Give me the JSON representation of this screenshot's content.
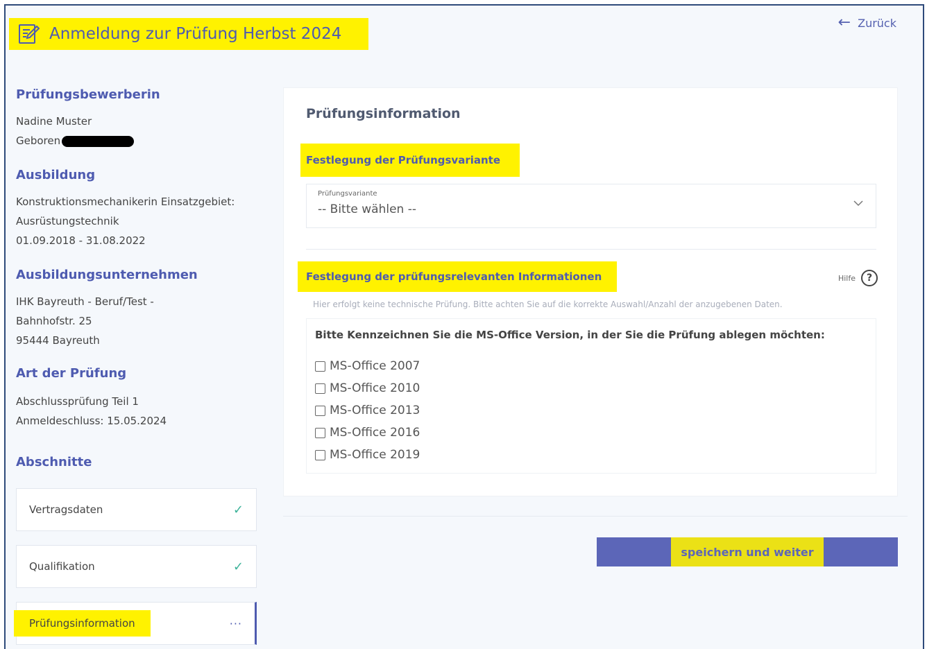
{
  "header": {
    "title": "Anmeldung zur Prüfung Herbst 2024",
    "back_label": "Zurück"
  },
  "sidebar": {
    "candidate_heading": "Prüfungsbewerberin",
    "candidate_name": "Nadine Muster",
    "born_label": "Geboren",
    "training_heading": "Ausbildung",
    "training_line1": "Konstruktionsmechanikerin Einsatzgebiet:",
    "training_line2": "Ausrüstungstechnik",
    "training_period": "01.09.2018 - 31.08.2022",
    "company_heading": "Ausbildungsunternehmen",
    "company_line1": "IHK Bayreuth - Beruf/Test -",
    "company_line2": "Bahnhofstr. 25",
    "company_line3": "95444 Bayreuth",
    "exam_type_heading": "Art der Prüfung",
    "exam_type": "Abschlussprüfung Teil 1",
    "deadline": "Anmeldeschluss: 15.05.2024",
    "sections_heading": "Abschnitte",
    "sections": [
      {
        "label": "Vertragsdaten",
        "status": "done"
      },
      {
        "label": "Qualifikation",
        "status": "done"
      },
      {
        "label": "Prüfungsinformation",
        "status": "active",
        "indicator": "···"
      }
    ]
  },
  "main": {
    "card_title": "Prüfungsinformation",
    "variant_heading": "Festlegung der Prüfungsvariante",
    "variant_select": {
      "label": "Prüfungsvariante",
      "value": "-- Bitte wählen --"
    },
    "relevant_heading": "Festlegung der prüfungsrelevanten Informationen",
    "help_label": "Hilfe",
    "hint": "Hier erfolgt keine technische Prüfung. Bitte achten Sie auf die korrekte Auswahl/Anzahl der anzugebenen Daten.",
    "question": "Bitte Kennzeichnen Sie die MS-Office Version, in der Sie die Prüfung ablegen möchten:",
    "options": [
      {
        "label": "MS-Office 2007",
        "checked": false
      },
      {
        "label": "MS-Office 2010",
        "checked": false
      },
      {
        "label": "MS-Office 2013",
        "checked": false
      },
      {
        "label": "MS-Office 2016",
        "checked": false
      },
      {
        "label": "MS-Office 2019",
        "checked": false
      }
    ],
    "save_label": "speichern und weiter"
  },
  "colors": {
    "accent": "#4e5bb0",
    "button": "#5c66b8",
    "highlight": "#fff200",
    "check": "#3db39a"
  }
}
